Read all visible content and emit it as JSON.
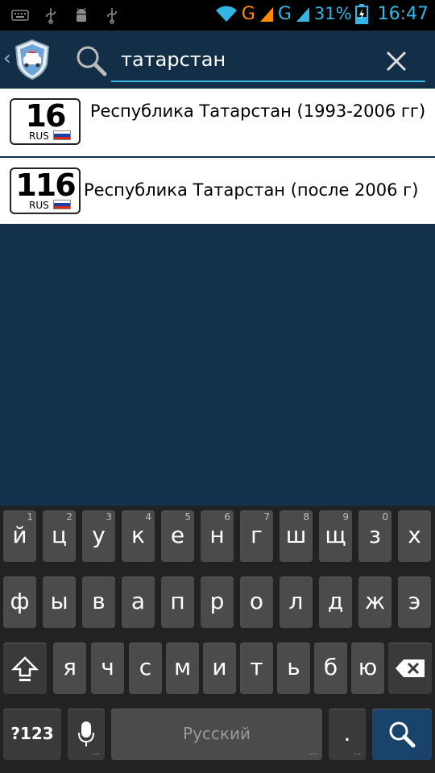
{
  "status_bar": {
    "network_1": "G",
    "network_2": "G",
    "battery_percent": "31%",
    "time": "16:47",
    "accent_color": "#33b5e5"
  },
  "action_bar": {
    "up_indicator": "‹",
    "search_query": "татарстан",
    "background_color": "#122f47"
  },
  "results": [
    {
      "plate_number": "16",
      "plate_country": "RUS",
      "label": "Республика Татарстан (1993-2006 гг)"
    },
    {
      "plate_number": "116",
      "plate_country": "RUS",
      "label": "Республика Татарстан (после 2006 г)"
    }
  ],
  "keyboard": {
    "row1": [
      {
        "key": "й",
        "hint": "1"
      },
      {
        "key": "ц",
        "hint": "2"
      },
      {
        "key": "у",
        "hint": "3"
      },
      {
        "key": "к",
        "hint": "4"
      },
      {
        "key": "е",
        "hint": "5"
      },
      {
        "key": "н",
        "hint": "6"
      },
      {
        "key": "г",
        "hint": "7"
      },
      {
        "key": "ш",
        "hint": "8"
      },
      {
        "key": "щ",
        "hint": "9"
      },
      {
        "key": "з",
        "hint": "0"
      },
      {
        "key": "х",
        "hint": ""
      }
    ],
    "row2": [
      "ф",
      "ы",
      "в",
      "а",
      "п",
      "р",
      "о",
      "л",
      "д",
      "ж",
      "э"
    ],
    "row3": [
      "я",
      "ч",
      "с",
      "м",
      "и",
      "т",
      "ь",
      "б",
      "ю"
    ],
    "mode_label": "?123",
    "space_label": "Русский",
    "period_label": ".",
    "icons": [
      "shift-icon",
      "delete-icon",
      "mic-icon",
      "search-icon"
    ]
  }
}
